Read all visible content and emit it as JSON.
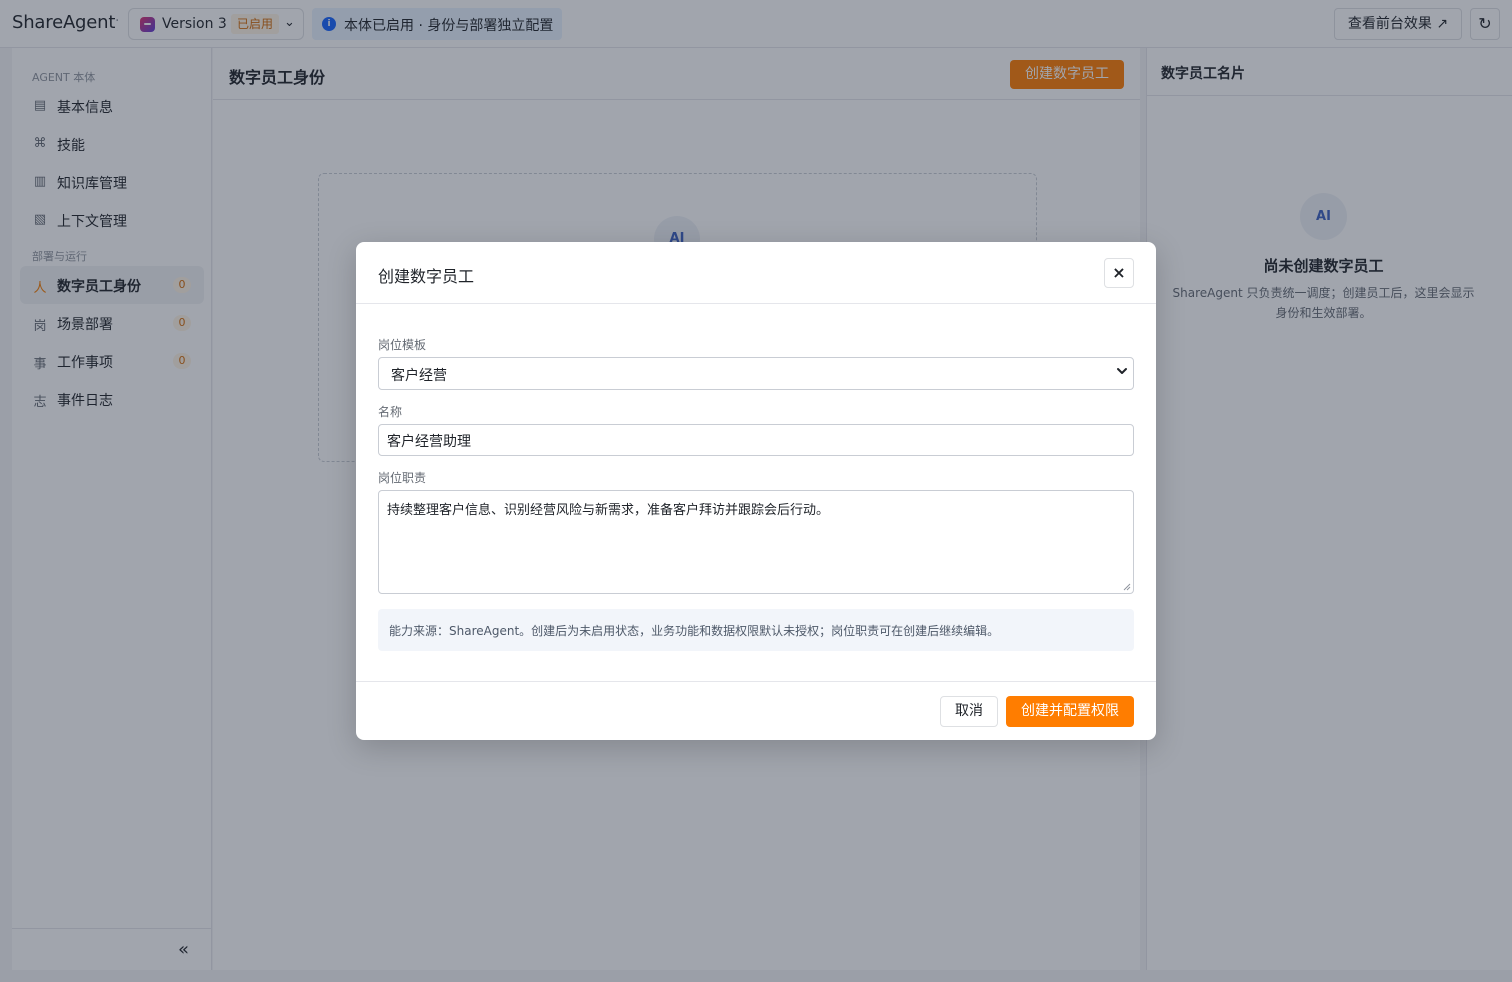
{
  "topbar": {
    "brand": "ShareAgent",
    "separator": "·",
    "version": {
      "name": "Version 3",
      "status": "已启用",
      "chevron": "⌄"
    },
    "info_text": "本体已启用 · 身份与部署独立配置",
    "info_icon": "i",
    "preview_label": "查看前台效果 ↗",
    "refresh_icon": "↻"
  },
  "sidebar": {
    "section1_label": "AGENT 本体",
    "section2_label": "部署与运行",
    "items": [
      {
        "icon": "▤",
        "label": "基本信息"
      },
      {
        "icon": "⌘",
        "label": "技能"
      },
      {
        "icon": "▥",
        "label": "知识库管理"
      },
      {
        "icon": "▧",
        "label": "上下文管理"
      },
      {
        "icon": "人",
        "label": "数字员工身份",
        "count": "0"
      },
      {
        "icon": "岗",
        "label": "场景部署",
        "count": "0"
      },
      {
        "icon": "事",
        "label": "工作事项",
        "count": "0"
      },
      {
        "icon": "志",
        "label": "事件日志"
      }
    ],
    "collapse_icon": "«"
  },
  "main": {
    "title": "数字员工身份",
    "create_label": "创建数字员工",
    "empty_ai": "AI"
  },
  "right_panel": {
    "title": "数字员工名片",
    "ai_label": "AI",
    "empty_title": "尚未创建数字员工",
    "empty_desc": "ShareAgent 只负责统一调度；创建员工后，这里会显示身份和生效部署。"
  },
  "modal": {
    "title": "创建数字员工",
    "close_icon": "×",
    "template_label": "岗位模板",
    "template_value": "客户经营",
    "name_label": "名称",
    "name_value": "客户经营助理",
    "duty_label": "岗位职责",
    "duty_value": "持续整理客户信息、识别经营风险与新需求，准备客户拜访并跟踪会后行动。",
    "notice": "能力来源：ShareAgent。创建后为未启用状态，业务功能和数据权限默认未授权；岗位职责可在创建后继续编辑。",
    "cancel_label": "取消",
    "confirm_label": "创建并配置权限"
  },
  "colors": {
    "accent": "#ff7d00",
    "badge_bg": "#fff4e5",
    "badge_text": "#d46b08",
    "info_bg": "#e8f3ff",
    "info_icon": "#1664ff"
  }
}
